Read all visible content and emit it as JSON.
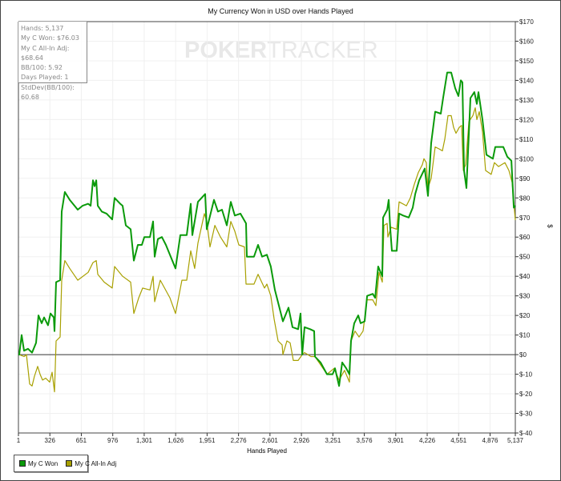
{
  "chart_data": {
    "type": "line",
    "title": "My Currency Won in USD over Hands Played",
    "xlabel": "Hands Played",
    "ylabel": "$",
    "xlim": [
      1,
      5137
    ],
    "ylim": [
      -40,
      170
    ],
    "x_ticks": [
      "1",
      "326",
      "651",
      "976",
      "1,301",
      "1,626",
      "1,951",
      "2,276",
      "2,601",
      "2,926",
      "3,251",
      "3,576",
      "3,901",
      "4,226",
      "4,551",
      "4,876",
      "5,137"
    ],
    "x_tick_values": [
      1,
      326,
      651,
      976,
      1301,
      1626,
      1951,
      2276,
      2601,
      2926,
      3251,
      3576,
      3901,
      4226,
      4551,
      4876,
      5137
    ],
    "y_ticks": [
      "$170",
      "$160",
      "$150",
      "$140",
      "$130",
      "$120",
      "$110",
      "$100",
      "$90",
      "$80",
      "$70",
      "$60",
      "$50",
      "$40",
      "$30",
      "$20",
      "$10",
      "$0",
      "$-10",
      "$-20",
      "$-30",
      "$-40"
    ],
    "y_tick_values": [
      170,
      160,
      150,
      140,
      130,
      120,
      110,
      100,
      90,
      80,
      70,
      60,
      50,
      40,
      30,
      20,
      10,
      0,
      -10,
      -20,
      -30,
      -40
    ],
    "grid": true,
    "legend_position": "bottom-left",
    "series": [
      {
        "name": "My C Won",
        "color": "#0a9a0a",
        "points": [
          [
            1,
            0
          ],
          [
            9,
            0
          ],
          [
            34,
            10
          ],
          [
            59,
            2
          ],
          [
            100,
            3
          ],
          [
            142,
            1
          ],
          [
            183,
            6
          ],
          [
            208,
            20
          ],
          [
            241,
            16
          ],
          [
            266,
            19
          ],
          [
            307,
            15
          ],
          [
            332,
            21
          ],
          [
            366,
            19
          ],
          [
            374,
            12
          ],
          [
            390,
            37
          ],
          [
            432,
            38
          ],
          [
            448,
            73
          ],
          [
            481,
            83
          ],
          [
            531,
            79
          ],
          [
            614,
            74
          ],
          [
            664,
            76
          ],
          [
            722,
            77
          ],
          [
            747,
            76
          ],
          [
            771,
            89
          ],
          [
            788,
            86
          ],
          [
            805,
            89
          ],
          [
            821,
            76
          ],
          [
            863,
            73
          ],
          [
            912,
            72
          ],
          [
            970,
            69
          ],
          [
            995,
            80
          ],
          [
            1053,
            77
          ],
          [
            1078,
            76
          ],
          [
            1111,
            66
          ],
          [
            1161,
            64
          ],
          [
            1194,
            48
          ],
          [
            1235,
            56
          ],
          [
            1277,
            56
          ],
          [
            1302,
            60
          ],
          [
            1360,
            60
          ],
          [
            1393,
            68
          ],
          [
            1409,
            50
          ],
          [
            1442,
            59
          ],
          [
            1484,
            60
          ],
          [
            1525,
            56
          ],
          [
            1567,
            51
          ],
          [
            1625,
            44
          ],
          [
            1674,
            61
          ],
          [
            1741,
            61
          ],
          [
            1782,
            77
          ],
          [
            1799,
            61
          ],
          [
            1857,
            78
          ],
          [
            1931,
            82
          ],
          [
            1948,
            64
          ],
          [
            2022,
            79
          ],
          [
            2064,
            73
          ],
          [
            2105,
            74
          ],
          [
            2155,
            66
          ],
          [
            2196,
            78
          ],
          [
            2238,
            71
          ],
          [
            2296,
            72
          ],
          [
            2354,
            67
          ],
          [
            2362,
            50
          ],
          [
            2436,
            50
          ],
          [
            2478,
            56
          ],
          [
            2519,
            50
          ],
          [
            2569,
            51
          ],
          [
            2610,
            45
          ],
          [
            2652,
            33
          ],
          [
            2693,
            25
          ],
          [
            2735,
            17
          ],
          [
            2793,
            24
          ],
          [
            2834,
            14
          ],
          [
            2892,
            13
          ],
          [
            2917,
            21
          ],
          [
            2934,
            0
          ],
          [
            2958,
            14
          ],
          [
            3016,
            13
          ],
          [
            3058,
            12
          ],
          [
            3066,
            -1
          ],
          [
            3124,
            -4
          ],
          [
            3190,
            -10
          ],
          [
            3248,
            -10
          ],
          [
            3273,
            -7
          ],
          [
            3315,
            -16
          ],
          [
            3348,
            -4
          ],
          [
            3389,
            -7
          ],
          [
            3422,
            -10
          ],
          [
            3439,
            7
          ],
          [
            3472,
            16
          ],
          [
            3513,
            20
          ],
          [
            3538,
            16
          ],
          [
            3580,
            17
          ],
          [
            3605,
            30
          ],
          [
            3663,
            31
          ],
          [
            3688,
            29
          ],
          [
            3720,
            45
          ],
          [
            3762,
            40
          ],
          [
            3770,
            70
          ],
          [
            3812,
            74
          ],
          [
            3828,
            79
          ],
          [
            3845,
            64
          ],
          [
            3861,
            53
          ],
          [
            3911,
            53
          ],
          [
            3936,
            72
          ],
          [
            3977,
            71
          ],
          [
            4035,
            70
          ],
          [
            4077,
            75
          ],
          [
            4102,
            82
          ],
          [
            4143,
            89
          ],
          [
            4201,
            95
          ],
          [
            4234,
            81
          ],
          [
            4267,
            108
          ],
          [
            4309,
            124
          ],
          [
            4367,
            123
          ],
          [
            4391,
            131
          ],
          [
            4433,
            144
          ],
          [
            4474,
            144
          ],
          [
            4516,
            136
          ],
          [
            4549,
            132
          ],
          [
            4574,
            140
          ],
          [
            4590,
            139
          ],
          [
            4607,
            94
          ],
          [
            4632,
            85
          ],
          [
            4673,
            131
          ],
          [
            4714,
            134
          ],
          [
            4739,
            128
          ],
          [
            4756,
            134
          ],
          [
            4797,
            120
          ],
          [
            4839,
            102
          ],
          [
            4905,
            100
          ],
          [
            4930,
            106
          ],
          [
            5013,
            106
          ],
          [
            5054,
            101
          ],
          [
            5096,
            99
          ],
          [
            5121,
            75
          ],
          [
            5137,
            76.03
          ]
        ]
      },
      {
        "name": "My C All-In Adj",
        "color": "#a8a000",
        "points": [
          [
            1,
            0
          ],
          [
            9,
            0
          ],
          [
            59,
            -1
          ],
          [
            84,
            0
          ],
          [
            117,
            -15
          ],
          [
            142,
            -16
          ],
          [
            167,
            -11
          ],
          [
            200,
            -6
          ],
          [
            225,
            -10
          ],
          [
            250,
            -13
          ],
          [
            283,
            -12
          ],
          [
            324,
            -14
          ],
          [
            349,
            -9
          ],
          [
            374,
            -19
          ],
          [
            390,
            7
          ],
          [
            432,
            9
          ],
          [
            448,
            38
          ],
          [
            481,
            48
          ],
          [
            531,
            44
          ],
          [
            614,
            38
          ],
          [
            722,
            42
          ],
          [
            771,
            47
          ],
          [
            805,
            48
          ],
          [
            821,
            41
          ],
          [
            887,
            37
          ],
          [
            970,
            34
          ],
          [
            995,
            45
          ],
          [
            1078,
            40
          ],
          [
            1161,
            37
          ],
          [
            1194,
            21
          ],
          [
            1244,
            29
          ],
          [
            1285,
            34
          ],
          [
            1360,
            33
          ],
          [
            1393,
            40
          ],
          [
            1409,
            27
          ],
          [
            1467,
            38
          ],
          [
            1567,
            29
          ],
          [
            1625,
            21
          ],
          [
            1691,
            38
          ],
          [
            1741,
            38
          ],
          [
            1782,
            53
          ],
          [
            1823,
            44
          ],
          [
            1857,
            57
          ],
          [
            1923,
            72
          ],
          [
            1948,
            68
          ],
          [
            1981,
            55
          ],
          [
            2031,
            66
          ],
          [
            2089,
            60
          ],
          [
            2155,
            55
          ],
          [
            2196,
            68
          ],
          [
            2238,
            63
          ],
          [
            2279,
            56
          ],
          [
            2337,
            55
          ],
          [
            2354,
            36
          ],
          [
            2436,
            36
          ],
          [
            2478,
            41
          ],
          [
            2544,
            34
          ],
          [
            2569,
            36
          ],
          [
            2610,
            30
          ],
          [
            2644,
            18
          ],
          [
            2685,
            7
          ],
          [
            2726,
            5
          ],
          [
            2735,
            0
          ],
          [
            2776,
            7
          ],
          [
            2809,
            6
          ],
          [
            2842,
            -3
          ],
          [
            2892,
            -3
          ],
          [
            2934,
            0
          ],
          [
            2958,
            1
          ],
          [
            3025,
            -1
          ],
          [
            3066,
            -1
          ],
          [
            3190,
            -10
          ],
          [
            3265,
            -7
          ],
          [
            3315,
            -13
          ],
          [
            3372,
            -8
          ],
          [
            3422,
            -14
          ],
          [
            3439,
            7
          ],
          [
            3480,
            12
          ],
          [
            3522,
            9
          ],
          [
            3563,
            12
          ],
          [
            3605,
            28
          ],
          [
            3663,
            28
          ],
          [
            3696,
            25
          ],
          [
            3729,
            42
          ],
          [
            3762,
            37
          ],
          [
            3779,
            66
          ],
          [
            3812,
            67
          ],
          [
            3820,
            60
          ],
          [
            3854,
            65
          ],
          [
            3911,
            64
          ],
          [
            3936,
            78
          ],
          [
            4011,
            76
          ],
          [
            4052,
            80
          ],
          [
            4093,
            87
          ],
          [
            4135,
            93
          ],
          [
            4176,
            97
          ],
          [
            4193,
            100
          ],
          [
            4217,
            98
          ],
          [
            4234,
            85
          ],
          [
            4267,
            90
          ],
          [
            4309,
            106
          ],
          [
            4350,
            105
          ],
          [
            4383,
            104
          ],
          [
            4408,
            110
          ],
          [
            4441,
            122
          ],
          [
            4474,
            122
          ],
          [
            4499,
            116
          ],
          [
            4524,
            113
          ],
          [
            4557,
            116
          ],
          [
            4582,
            117
          ],
          [
            4599,
            94
          ],
          [
            4623,
            97
          ],
          [
            4657,
            119
          ],
          [
            4698,
            122
          ],
          [
            4723,
            126
          ],
          [
            4739,
            120
          ],
          [
            4764,
            124
          ],
          [
            4797,
            114
          ],
          [
            4830,
            94
          ],
          [
            4888,
            92
          ],
          [
            4921,
            98
          ],
          [
            4963,
            96
          ],
          [
            5029,
            98
          ],
          [
            5071,
            94
          ],
          [
            5104,
            88
          ],
          [
            5137,
            68.64
          ]
        ]
      }
    ]
  },
  "stats": {
    "hands": "Hands: 5,137",
    "won": "My C Won: $76.03",
    "allin": "My C All-In Adj: $68.64",
    "bb100": "BB/100: 5.92",
    "days": "Days Played: 1",
    "stddev": "StdDev(BB/100): 60.68"
  },
  "watermark": {
    "poker": "POKER",
    "tracker": "TRACKER"
  }
}
